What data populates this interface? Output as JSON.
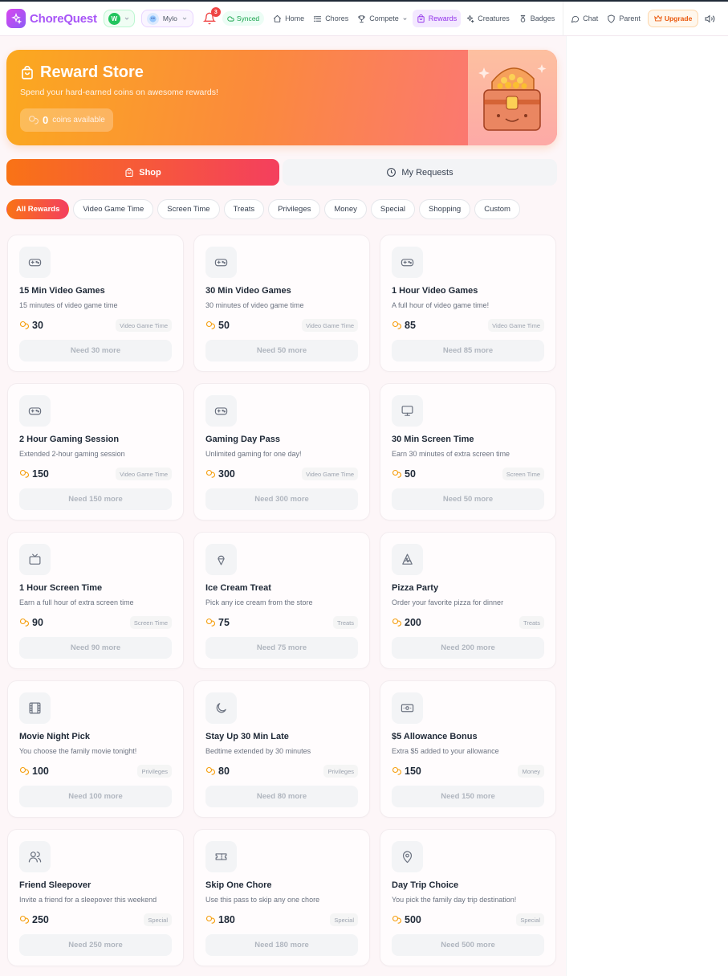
{
  "app": {
    "name": "ChoreQuest",
    "accent": "#a855f7",
    "brand_gradient": [
      "#f97316",
      "#f43f5e"
    ]
  },
  "nav": {
    "family_initial": "W",
    "child_name": "Mylo",
    "notification_count": "3",
    "sync_status": "Synced",
    "items": [
      {
        "label": "Home",
        "icon": "home-icon"
      },
      {
        "label": "Chores",
        "icon": "list-icon"
      },
      {
        "label": "Compete",
        "icon": "trophy-icon"
      },
      {
        "label": "Rewards",
        "icon": "gift-icon",
        "active": true
      },
      {
        "label": "Creatures",
        "icon": "sparkles-icon"
      },
      {
        "label": "Badges",
        "icon": "medal-icon"
      }
    ],
    "chat_label": "Chat",
    "parent_label": "Parent",
    "upgrade_label": "Upgrade"
  },
  "hero": {
    "title": "Reward Store",
    "subtitle": "Spend your hard-earned coins on awesome rewards!",
    "coins": "0",
    "coins_label": "coins available"
  },
  "tabs": {
    "shop": "Shop",
    "requests": "My Requests"
  },
  "filters": [
    "All Rewards",
    "Video Game Time",
    "Screen Time",
    "Treats",
    "Privileges",
    "Money",
    "Special",
    "Shopping",
    "Custom"
  ],
  "rewards": [
    {
      "title": "15 Min Video Games",
      "desc": "15 minutes of video game time",
      "cost": "30",
      "category": "Video Game Time",
      "need": "Need 30 more",
      "icon": "gamepad-icon"
    },
    {
      "title": "30 Min Video Games",
      "desc": "30 minutes of video game time",
      "cost": "50",
      "category": "Video Game Time",
      "need": "Need 50 more",
      "icon": "gamepad-icon"
    },
    {
      "title": "1 Hour Video Games",
      "desc": "A full hour of video game time!",
      "cost": "85",
      "category": "Video Game Time",
      "need": "Need 85 more",
      "icon": "gamepad-icon"
    },
    {
      "title": "2 Hour Gaming Session",
      "desc": "Extended 2-hour gaming session",
      "cost": "150",
      "category": "Video Game Time",
      "need": "Need 150 more",
      "icon": "gamepad-icon"
    },
    {
      "title": "Gaming Day Pass",
      "desc": "Unlimited gaming for one day!",
      "cost": "300",
      "category": "Video Game Time",
      "need": "Need 300 more",
      "icon": "gamepad-icon"
    },
    {
      "title": "30 Min Screen Time",
      "desc": "Earn 30 minutes of extra screen time",
      "cost": "50",
      "category": "Screen Time",
      "need": "Need 50 more",
      "icon": "monitor-icon"
    },
    {
      "title": "1 Hour Screen Time",
      "desc": "Earn a full hour of extra screen time",
      "cost": "90",
      "category": "Screen Time",
      "need": "Need 90 more",
      "icon": "tv-icon"
    },
    {
      "title": "Ice Cream Treat",
      "desc": "Pick any ice cream from the store",
      "cost": "75",
      "category": "Treats",
      "need": "Need 75 more",
      "icon": "ice-cream-icon"
    },
    {
      "title": "Pizza Party",
      "desc": "Order your favorite pizza for dinner",
      "cost": "200",
      "category": "Treats",
      "need": "Need 200 more",
      "icon": "pizza-icon"
    },
    {
      "title": "Movie Night Pick",
      "desc": "You choose the family movie tonight!",
      "cost": "100",
      "category": "Privileges",
      "need": "Need 100 more",
      "icon": "film-icon"
    },
    {
      "title": "Stay Up 30 Min Late",
      "desc": "Bedtime extended by 30 minutes",
      "cost": "80",
      "category": "Privileges",
      "need": "Need 80 more",
      "icon": "moon-icon"
    },
    {
      "title": "$5 Allowance Bonus",
      "desc": "Extra $5 added to your allowance",
      "cost": "150",
      "category": "Money",
      "need": "Need 150 more",
      "icon": "banknote-icon"
    },
    {
      "title": "Friend Sleepover",
      "desc": "Invite a friend for a sleepover this weekend",
      "cost": "250",
      "category": "Special",
      "need": "Need 250 more",
      "icon": "users-icon"
    },
    {
      "title": "Skip One Chore",
      "desc": "Use this pass to skip any one chore",
      "cost": "180",
      "category": "Special",
      "need": "Need 180 more",
      "icon": "ticket-icon"
    },
    {
      "title": "Day Trip Choice",
      "desc": "You pick the family day trip destination!",
      "cost": "500",
      "category": "Special",
      "need": "Need 500 more",
      "icon": "map-pin-icon"
    }
  ]
}
